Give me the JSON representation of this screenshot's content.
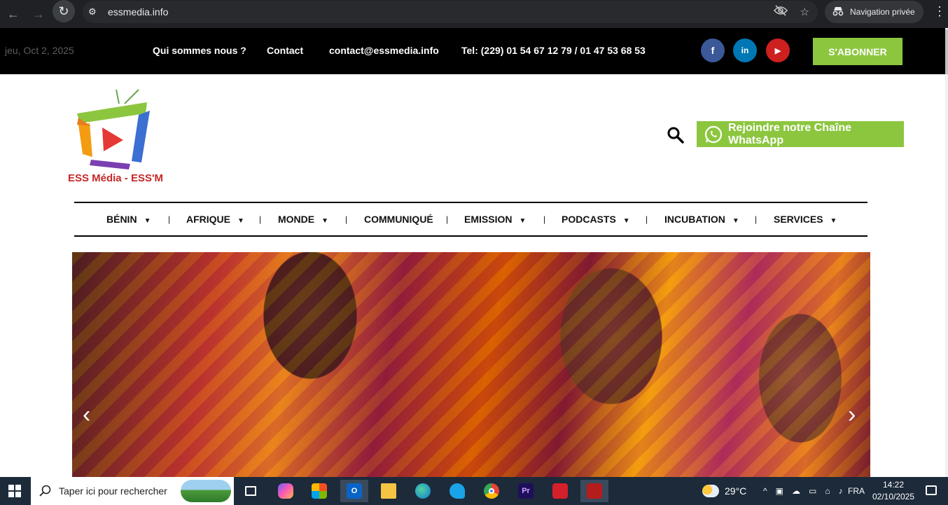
{
  "browser": {
    "url": "essmedia.info",
    "incognito_label": "Navigation privée"
  },
  "topbar": {
    "date": "jeu, Oct 2, 2025",
    "links": {
      "about": "Qui sommes nous ?",
      "contact": "Contact",
      "email": "contact@essmedia.info",
      "phone": "Tel: (229) 01 54 67 12 79 / 01 47 53 68 53"
    },
    "social": {
      "facebook": "f",
      "linkedin": "in",
      "youtube": "▶"
    },
    "subscribe_label": "S'ABONNER"
  },
  "header": {
    "logo_text": "ESS Média - ESS'M",
    "whatsapp_label": "Rejoindre notre Chaîne WhatsApp"
  },
  "nav": {
    "items": [
      {
        "label": "BÉNIN",
        "dropdown": "▼"
      },
      {
        "label": "AFRIQUE",
        "dropdown": "▼"
      },
      {
        "label": "MONDE",
        "dropdown": "▼"
      },
      {
        "label": "COMMUNIQUÉ",
        "dropdown": ""
      },
      {
        "label": "EMISSION",
        "dropdown": "▼"
      },
      {
        "label": "PODCASTS",
        "dropdown": "▼"
      },
      {
        "label": "INCUBATION",
        "dropdown": "▼"
      },
      {
        "label": "SERVICES",
        "dropdown": "▼"
      }
    ],
    "separator": "|"
  },
  "hero": {
    "prev": "‹",
    "next": "›"
  },
  "taskbar": {
    "search_placeholder": "Taper ici pour rechercher",
    "weather": "29°C",
    "language": "FRA",
    "time": "14:22",
    "date": "02/10/2025",
    "apps": {
      "outlook": "O",
      "premiere": "Pr"
    }
  },
  "colors": {
    "accent_green": "#8cc63f",
    "facebook": "#3b5998",
    "linkedin": "#0077b5",
    "youtube": "#cd201f"
  }
}
